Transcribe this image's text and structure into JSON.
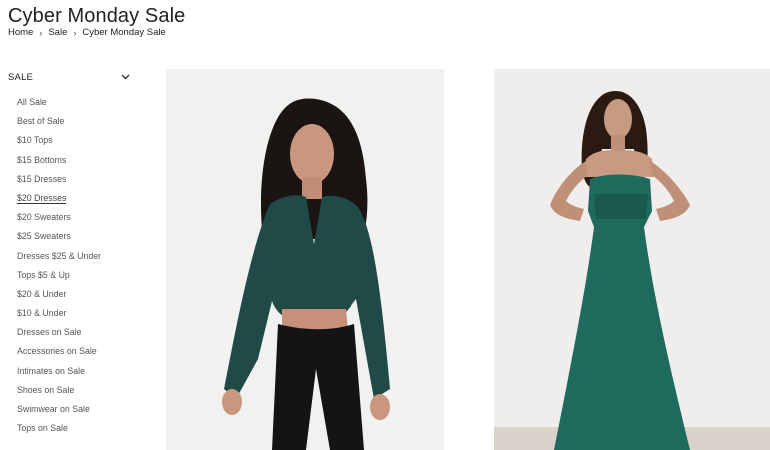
{
  "page": {
    "title": "Cyber Monday Sale",
    "breadcrumb": [
      "Home",
      "Sale",
      "Cyber Monday Sale"
    ]
  },
  "sidebar": {
    "heading": "SALE",
    "items": [
      {
        "label": "All Sale"
      },
      {
        "label": "Best of Sale"
      },
      {
        "label": "$10 Tops"
      },
      {
        "label": "$15 Bottoms"
      },
      {
        "label": "$15 Dresses"
      },
      {
        "label": "$20 Dresses",
        "active": true
      },
      {
        "label": "$20 Sweaters"
      },
      {
        "label": "$25 Sweaters"
      },
      {
        "label": "Dresses $25 & Under"
      },
      {
        "label": "Tops $5 & Up"
      },
      {
        "label": "$20 & Under"
      },
      {
        "label": "$10 & Under"
      },
      {
        "label": "Dresses on Sale"
      },
      {
        "label": "Accessories on Sale"
      },
      {
        "label": "Intimates on Sale"
      },
      {
        "label": "Shoes on Sale"
      },
      {
        "label": "Swimwear on Sale"
      },
      {
        "label": "Tops on Sale"
      }
    ]
  },
  "products": [
    {
      "image": "model-green-tie-front-blouse-black-pants",
      "top_color": "#1f4a48",
      "bottom_color": "#141414"
    },
    {
      "image": "model-green-strapless-maxi-dress",
      "dress_color": "#1e6b5d"
    }
  ]
}
